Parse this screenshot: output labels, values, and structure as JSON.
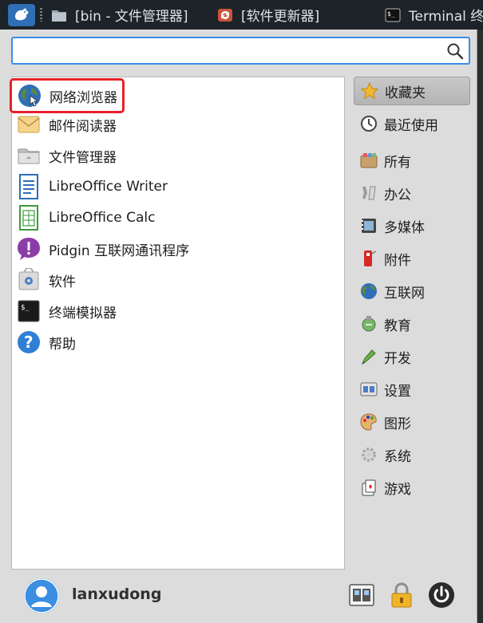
{
  "taskbar": {
    "tasks": [
      {
        "label": "[bin - 文件管理器]",
        "icon": "folder-icon"
      },
      {
        "label": "[软件更新器]",
        "icon": "software-updater-icon"
      },
      {
        "label": "Terminal 终",
        "icon": "terminal-icon"
      }
    ]
  },
  "search": {
    "value": "",
    "placeholder": ""
  },
  "apps": [
    {
      "label": "网络浏览器",
      "icon": "web-browser-icon",
      "selected": true
    },
    {
      "label": "邮件阅读器",
      "icon": "mail-reader-icon"
    },
    {
      "label": "文件管理器",
      "icon": "file-manager-icon"
    },
    {
      "label": "LibreOffice Writer",
      "icon": "libreoffice-writer-icon"
    },
    {
      "label": "LibreOffice Calc",
      "icon": "libreoffice-calc-icon"
    },
    {
      "label": "Pidgin 互联网通讯程序",
      "icon": "pidgin-icon"
    },
    {
      "label": "软件",
      "icon": "software-icon"
    },
    {
      "label": "终端模拟器",
      "icon": "terminal-emulator-icon"
    },
    {
      "label": "帮助",
      "icon": "help-icon"
    }
  ],
  "categories": [
    {
      "label": "收藏夹",
      "icon": "star-icon",
      "active": true
    },
    {
      "label": "最近使用",
      "icon": "clock-icon"
    },
    {
      "label": "所有",
      "icon": "all-apps-icon"
    },
    {
      "label": "办公",
      "icon": "office-icon"
    },
    {
      "label": "多媒体",
      "icon": "multimedia-icon"
    },
    {
      "label": "附件",
      "icon": "accessories-icon"
    },
    {
      "label": "互联网",
      "icon": "internet-icon"
    },
    {
      "label": "教育",
      "icon": "education-icon"
    },
    {
      "label": "开发",
      "icon": "development-icon"
    },
    {
      "label": "设置",
      "icon": "settings-icon"
    },
    {
      "label": "图形",
      "icon": "graphics-icon"
    },
    {
      "label": "系统",
      "icon": "system-icon"
    },
    {
      "label": "游戏",
      "icon": "games-icon"
    }
  ],
  "user": {
    "name": "lanxudong"
  },
  "colors": {
    "accent": "#3c8ce7",
    "highlight": "#e8202a",
    "panel": "#1d2328"
  }
}
